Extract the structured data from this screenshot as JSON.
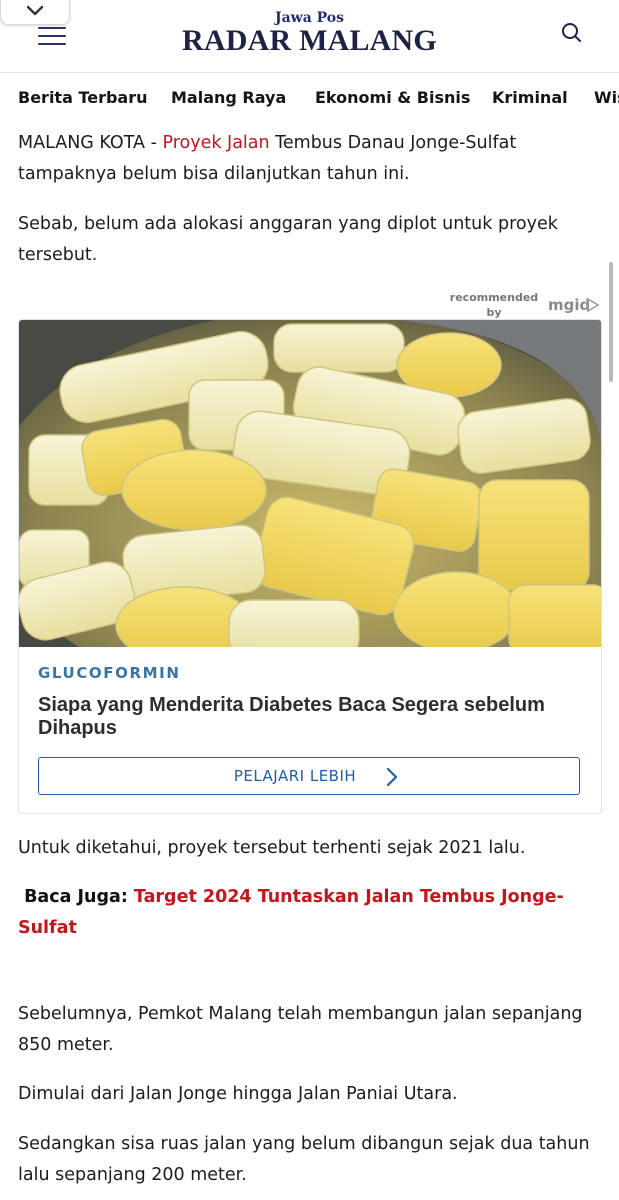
{
  "header": {
    "brand_top": "Jawa Pos",
    "brand_main": "RADAR MALANG",
    "collapse_icon": "chevron-down-icon",
    "menu_icon": "hamburger-menu-icon",
    "search_icon": "search-icon"
  },
  "nav": {
    "items": [
      "Berita Terbaru",
      "Malang Raya",
      "Ekonomi & Bisnis",
      "Kriminal",
      "Wis"
    ]
  },
  "article": {
    "p1_lead": "MALANG KOTA - ",
    "p1_link": "Proyek Jalan",
    "p1_rest": " Tembus Danau Jonge-Sulfat tampaknya belum bisa dilanjutkan tahun ini.",
    "p2": "Sebab, belum ada alokasi anggaran yang diplot untuk proyek tersebut.",
    "p3": "Untuk diketahui, proyek tersebut terhenti sejak 2021 lalu.",
    "baca_label": "Baca Juga: ",
    "baca_title": "Target 2024 Tuntaskan Jalan Tembus Jonge-Sulfat",
    "p4": "Sebelumnya, Pemkot Malang telah membangun jalan sepanjang 850 meter.",
    "p5": "Dimulai dari Jalan Jonge hingga Jalan Paniai Utara.",
    "p6": "Sedangkan sisa ruas jalan yang belum dibangun sejak dua tahun lalu sepanjang 200 meter."
  },
  "ad": {
    "recommended_by": "recommended by",
    "network": "mgid",
    "brand": "GLUCOFORMIN",
    "title": "Siapa yang Menderita Diabetes Baca Segera sebelum Dihapus",
    "cta": "PELAJARI LEBIH",
    "image_alt": "Banana pieces boiling in a pot"
  },
  "colors": {
    "link_red": "#c4161c",
    "brand_navy": "#1e2345",
    "ad_blue": "#1f5ea8"
  }
}
